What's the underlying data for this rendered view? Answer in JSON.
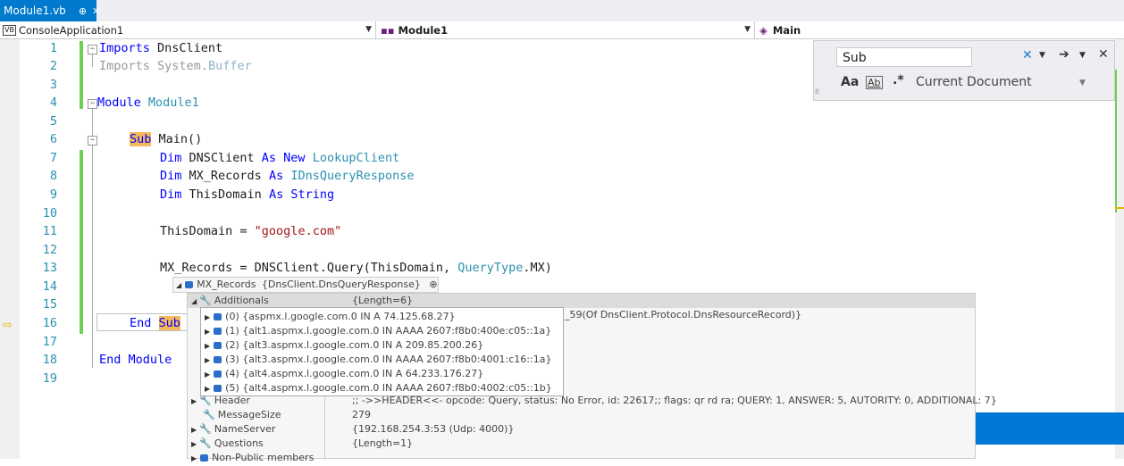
{
  "tab": {
    "title": "Module1.vb",
    "pin": "⊕",
    "close": "✕"
  },
  "nav": {
    "project": "ConsoleApplication1",
    "module": "Module1",
    "member": "Main",
    "vb": "VB"
  },
  "find": {
    "query": "Sub",
    "scope": "Current Document",
    "aa": "Aa",
    "ab": "Ab"
  },
  "lines": [
    "1",
    "2",
    "3",
    "4",
    "5",
    "6",
    "7",
    "8",
    "9",
    "10",
    "11",
    "12",
    "13",
    "14",
    "15",
    "16",
    "17",
    "18",
    "19"
  ],
  "code": {
    "l1_kw": "Imports",
    "l1_rest": " DnsClient",
    "l2_kw": "Imports",
    "l2_a": " System.",
    "l2_b": "Buffer",
    "l4_kw": "Module",
    "l4_ty": " Module1",
    "l6_sub": "Sub",
    "l6_rest": " Main()",
    "l7_dim": "Dim",
    "l7_a": " DNSClient ",
    "l7_as": "As New",
    "l7_ty": " LookupClient",
    "l8_dim": "Dim",
    "l8_a": " MX_Records ",
    "l8_as": "As",
    "l8_ty": " IDnsQueryResponse",
    "l9_dim": "Dim",
    "l9_a": " ThisDomain ",
    "l9_as": "As String",
    "l11_a": "ThisDomain = ",
    "l11_st": "\"google.com\"",
    "l13_a": "MX_Records = DNSClient.Query(ThisDomain, ",
    "l13_ty": "QueryType",
    "l13_b": ".MX)",
    "l16_end": "End",
    "l16_sub": "Sub",
    "l18": "End Module"
  },
  "datatip": {
    "root_name": "MX_Records",
    "root_value": "{DnsClient.DnsQueryResponse}",
    "additionals_name": "Additionals",
    "additionals_value": "{Length=6}",
    "answers_type_tail": "_59(Of DnsClient.Protocol.DnsResourceRecord)}",
    "items": [
      {
        "idx": "(0)",
        "value": "{aspmx.l.google.com.0 IN A 74.125.68.27}"
      },
      {
        "idx": "(1)",
        "value": "{alt1.aspmx.l.google.com.0 IN AAAA 2607:f8b0:400e:c05::1a}"
      },
      {
        "idx": "(2)",
        "value": "{alt3.aspmx.l.google.com.0 IN A 209.85.200.26}"
      },
      {
        "idx": "(3)",
        "value": "{alt3.aspmx.l.google.com.0 IN AAAA 2607:f8b0:4001:c16::1a}"
      },
      {
        "idx": "(4)",
        "value": "{alt4.aspmx.l.google.com.0 IN A 64.233.176.27}"
      },
      {
        "idx": "(5)",
        "value": "{alt4.aspmx.l.google.com.0 IN AAAA 2607:f8b0:4002:c05::1b}"
      }
    ],
    "header_name": "Header",
    "header_value": ";; ->>HEADER<<- opcode: Query, status: No Error, id: 22617;; flags: qr rd ra; QUERY: 1, ANSWER: 5, AUTORITY: 0, ADDITIONAL: 7}",
    "msgsize_name": "MessageSize",
    "msgsize_value": "279",
    "ns_name": "NameServer",
    "ns_value": "{192.168.254.3:53 (Udp: 4000)}",
    "questions_name": "Questions",
    "questions_value": "{Length=1}",
    "nonpublic_name": "Non-Public members"
  }
}
